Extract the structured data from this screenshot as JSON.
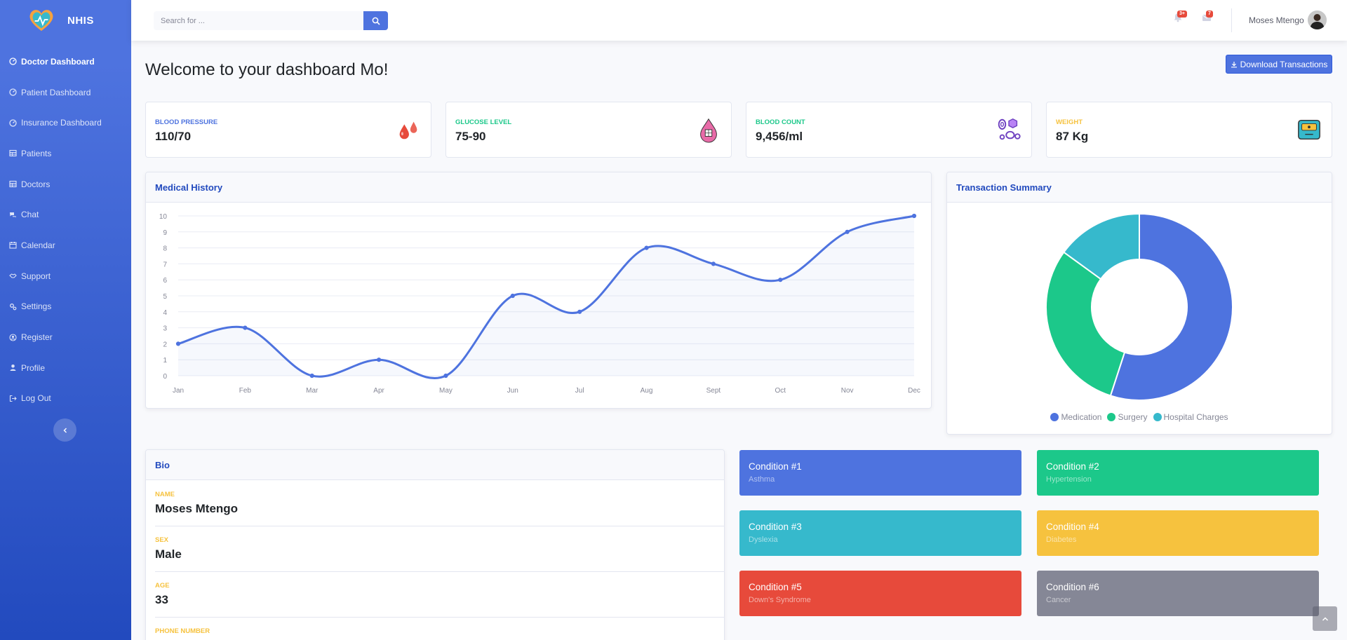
{
  "brand": {
    "name": "NHIS"
  },
  "sidebar": {
    "items": [
      {
        "label": "Doctor Dashboard",
        "icon": "gauge-icon",
        "active": true
      },
      {
        "label": "Patient Dashboard",
        "icon": "gauge-icon"
      },
      {
        "label": "Insurance Dashboard",
        "icon": "gauge-icon"
      },
      {
        "label": "Patients",
        "icon": "table-icon"
      },
      {
        "label": "Doctors",
        "icon": "table-icon"
      },
      {
        "label": "Chat",
        "icon": "comments-icon"
      },
      {
        "label": "Calendar",
        "icon": "calendar-icon"
      },
      {
        "label": "Support",
        "icon": "handshake-icon"
      },
      {
        "label": "Settings",
        "icon": "cogs-icon"
      },
      {
        "label": "Register",
        "icon": "user-circle-icon"
      },
      {
        "label": "Profile",
        "icon": "user-icon"
      },
      {
        "label": "Log Out",
        "icon": "sign-out-icon"
      }
    ]
  },
  "topbar": {
    "search_placeholder": "Search for ...",
    "alerts_badge": "3+",
    "messages_badge": "7",
    "user_name": "Moses Mtengo"
  },
  "page": {
    "title": "Welcome to your dashboard Mo!",
    "download_label": "Download Transactions"
  },
  "stats": [
    {
      "label": "Blood Pressure",
      "value": "110/70",
      "color": "#4e73df",
      "icon": "blood-drops-icon"
    },
    {
      "label": "Glucose Level",
      "value": "75-90",
      "color": "#1cc88a",
      "icon": "sugar-drop-icon"
    },
    {
      "label": "Blood Count",
      "value": "9,456/ml",
      "color": "#1cc88a",
      "icon": "blood-cells-icon"
    },
    {
      "label": "Weight",
      "value": "87 Kg",
      "color": "#f6c23e",
      "icon": "weight-scale-icon"
    }
  ],
  "medical_history": {
    "title": "Medical History"
  },
  "transaction_summary": {
    "title": "Transaction Summary"
  },
  "chart_data": [
    {
      "type": "line",
      "categories": [
        "Jan",
        "Feb",
        "Mar",
        "Apr",
        "May",
        "Jun",
        "Jul",
        "Aug",
        "Sept",
        "Oct",
        "Nov",
        "Dec"
      ],
      "values": [
        2,
        3,
        0,
        1,
        0,
        5,
        4,
        8,
        7,
        6,
        9,
        10
      ],
      "ylim": [
        0,
        10
      ],
      "yticks": [
        0,
        1,
        2,
        3,
        4,
        5,
        6,
        7,
        8,
        9,
        10
      ],
      "grid": true,
      "color": "#4e73df"
    },
    {
      "type": "pie",
      "donut": true,
      "categories": [
        "Medication",
        "Surgery",
        "Hospital Charges"
      ],
      "values": [
        55,
        30,
        15
      ],
      "colors": [
        "#4e73df",
        "#1cc88a",
        "#36b9cc"
      ],
      "legend": "bottom"
    }
  ],
  "bio": {
    "title": "Bio",
    "fields": [
      {
        "label": "Name",
        "value": "Moses Mtengo"
      },
      {
        "label": "Sex",
        "value": "Male"
      },
      {
        "label": "Age",
        "value": "33"
      },
      {
        "label": "Phone Number",
        "value": ""
      }
    ]
  },
  "conditions": [
    {
      "title": "Condition #1",
      "name": "Asthma",
      "color": "#4e73df"
    },
    {
      "title": "Condition #2",
      "name": "Hypertension",
      "color": "#1cc88a"
    },
    {
      "title": "Condition #3",
      "name": "Dyslexia",
      "color": "#36b9cc"
    },
    {
      "title": "Condition #4",
      "name": "Diabetes",
      "color": "#f6c23e"
    },
    {
      "title": "Condition #5",
      "name": "Down's Syndrome",
      "color": "#e74a3b"
    },
    {
      "title": "Condition #6",
      "name": "Cancer",
      "color": "#858796"
    }
  ]
}
